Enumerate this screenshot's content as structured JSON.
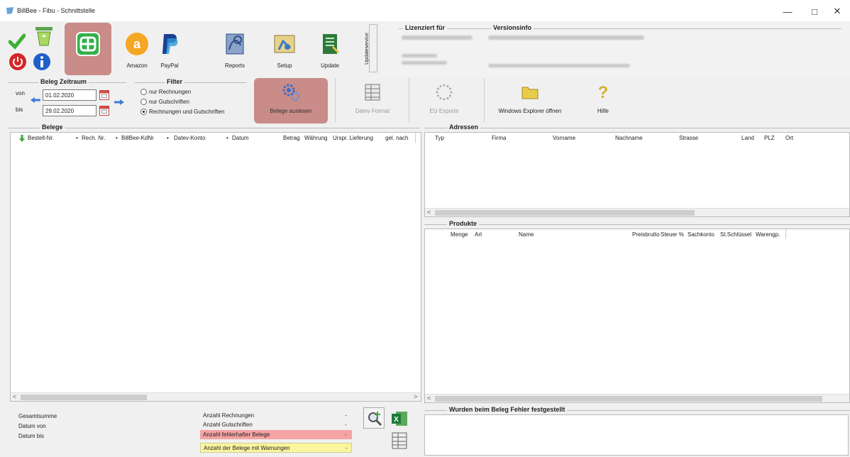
{
  "window": {
    "title": "BillBee - Fibu - Schnittstelle",
    "minimize": "—",
    "maximize": "□",
    "close": "✕"
  },
  "toolbar": {
    "buttons": [
      {
        "label": "Billbee",
        "icon": "billbee-icon"
      },
      {
        "label": "Amazon",
        "icon": "amazon-icon"
      },
      {
        "label": "PayPal",
        "icon": "paypal-icon"
      },
      {
        "label": "Reports",
        "icon": "reports-icon"
      },
      {
        "label": "Setup",
        "icon": "setup-icon"
      },
      {
        "label": "Update",
        "icon": "update-icon"
      }
    ],
    "update_service_label": "Updateservice"
  },
  "license": {
    "legend": "Lizenziert für",
    "version_legend": "Versionsinfo"
  },
  "period": {
    "legend": "Beleg Zeitraum",
    "from_label": "von",
    "to_label": "bis",
    "from_value": "01.02.2020",
    "to_value": "29.02.2020"
  },
  "filter": {
    "legend": "Filter",
    "options": [
      "nur Rechnungen",
      "nur Gutschriften",
      "Rechnungen und Gutschriften"
    ],
    "selected": 2
  },
  "actions": {
    "read": "Belege auslesen",
    "datev": "Datev Format",
    "eu": "EU Exporte",
    "explorer": "Windows Explorer öffnen",
    "help": "Hilfe"
  },
  "belege": {
    "legend": "Belege",
    "columns": [
      "Bestell-Nr.",
      "Rech. Nr.",
      "BillBee-KdNr",
      "Datev-Konto",
      "Datum",
      "Betrag",
      "Währung",
      "Urspr. Lieferung",
      "gel. nach"
    ]
  },
  "adressen": {
    "legend": "Adressen",
    "columns": [
      "Typ",
      "Firma",
      "Vorname",
      "Nachname",
      "Strasse",
      "Land",
      "PLZ",
      "Ort"
    ]
  },
  "produkte": {
    "legend": "Produkte",
    "columns": [
      "Menge",
      "Art",
      "Name",
      "Preisbrutto",
      "Steuer %",
      "Sachkonto",
      "St.Schlüssel",
      "Warengp."
    ]
  },
  "fehler": {
    "legend": "Wurden beim Beleg Fehler festgestellt"
  },
  "summary": {
    "left": [
      "Gesamtsumme",
      "Datum von",
      "Datum bis"
    ],
    "right": [
      {
        "label": "Anzahl Rechnungen",
        "value": "-"
      },
      {
        "label": "Anzahl Gutschriften",
        "value": "-"
      },
      {
        "label": "Anzahl fehlerhafter Belege",
        "value": "-"
      },
      {
        "label": "Anzahl der Belege mit Warnungen",
        "value": "-"
      }
    ]
  },
  "colors": {
    "accent_red": "#c98c88",
    "error_row": "#f5a3a3",
    "warn_row": "#fbf59e",
    "led_red": "#e02020",
    "led_yellow": "#9a8a10",
    "led_green": "#1e8a1e"
  },
  "scroll": {
    "left": "<",
    "right": ">"
  }
}
